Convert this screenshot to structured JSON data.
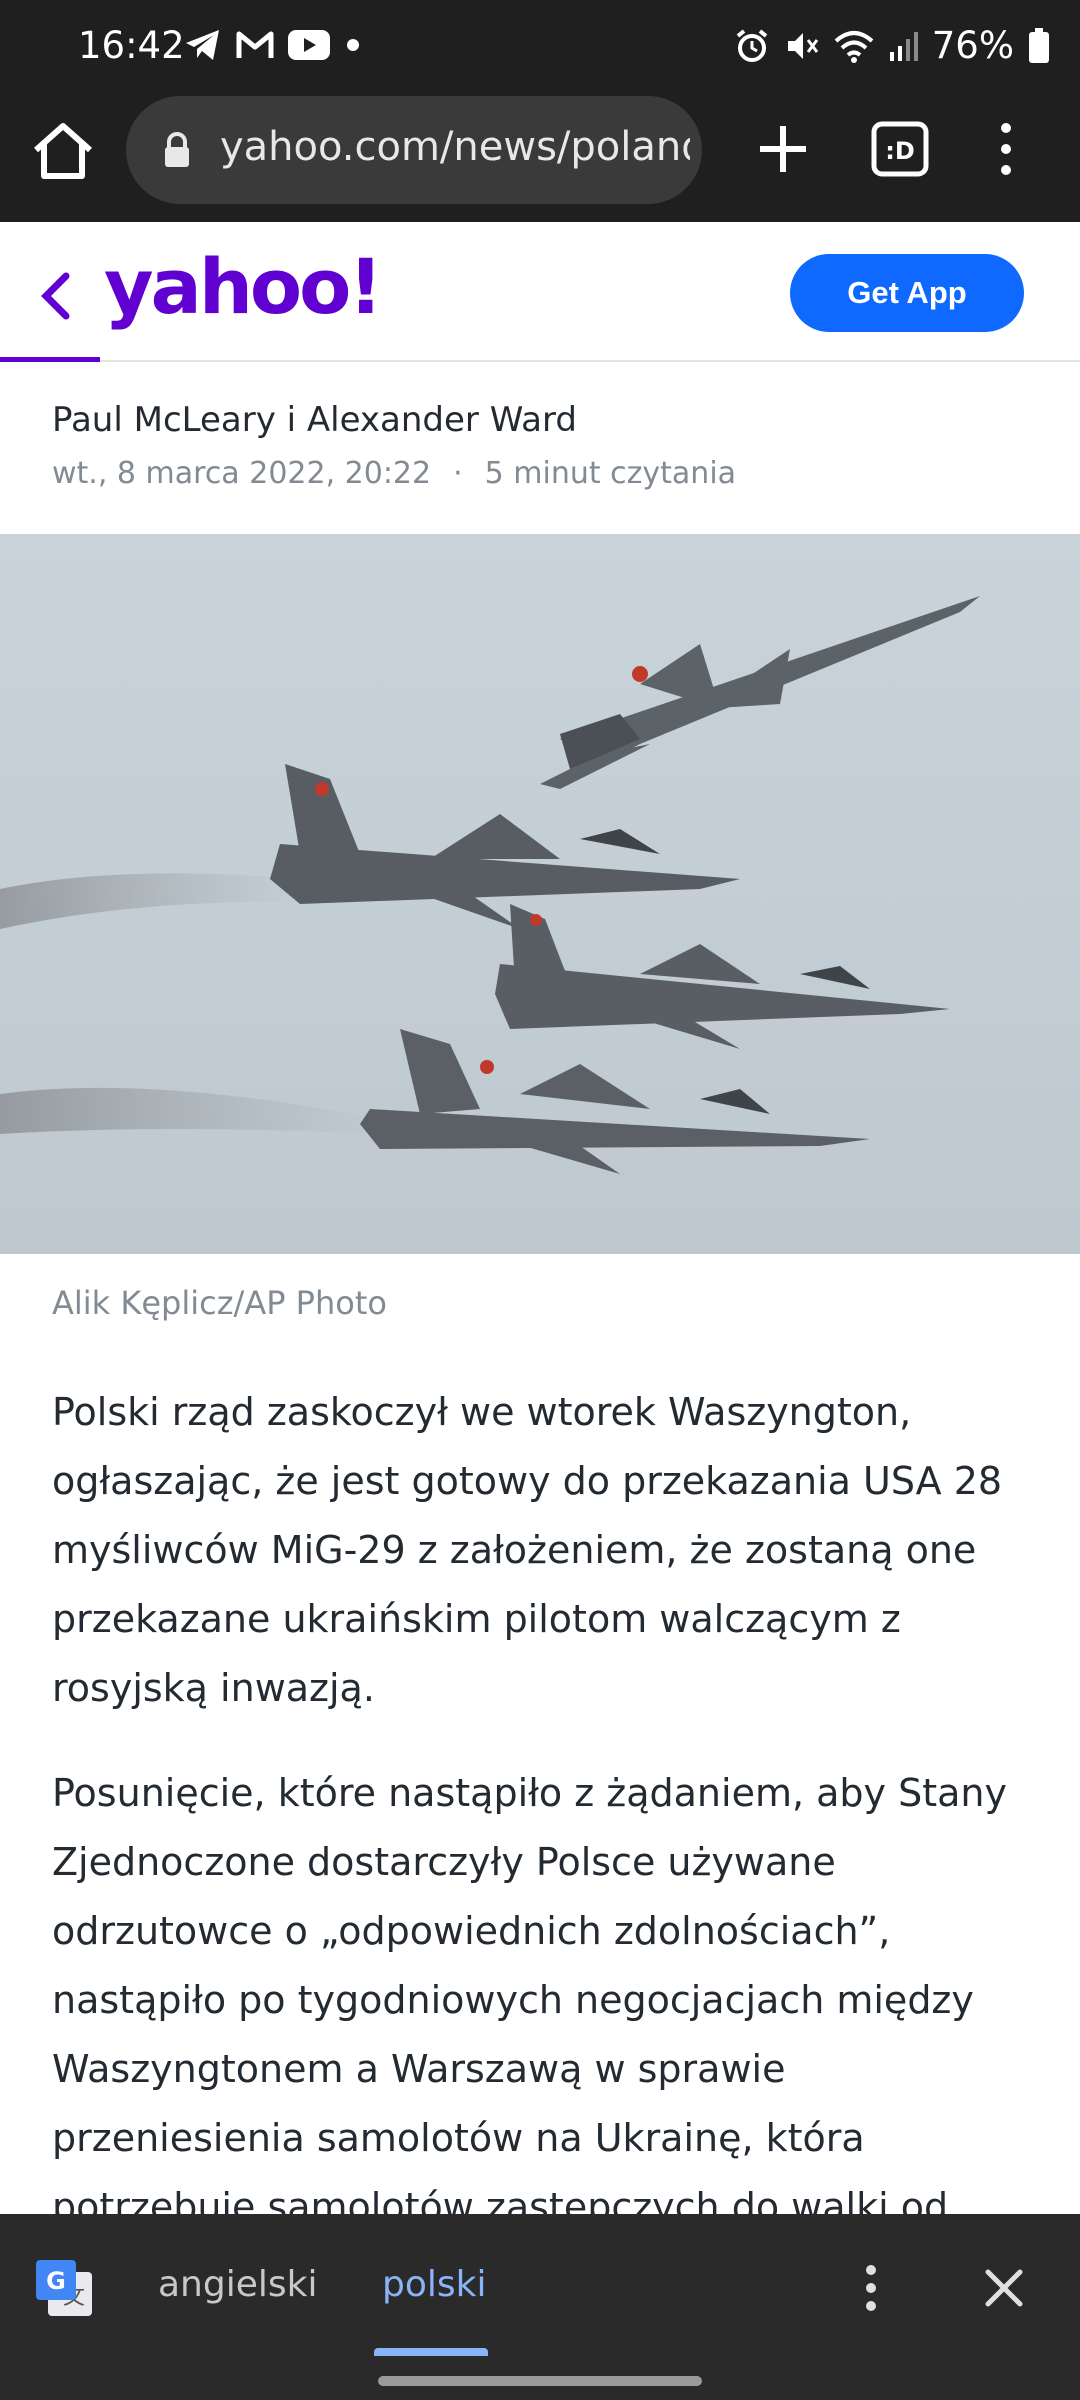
{
  "status_bar": {
    "time": "16:42",
    "battery": "76%",
    "left_icons": [
      "telegram-icon",
      "gmail-icon",
      "youtube-icon",
      "dot-icon"
    ],
    "right_icons": [
      "alarm-icon",
      "mute-icon",
      "wifi-icon",
      "signal-icon",
      "battery-icon"
    ]
  },
  "browser": {
    "url": "yahoo.com/news/poland"
  },
  "header": {
    "logo": "yahoo!",
    "get_app": "Get App"
  },
  "article": {
    "authors": "Paul McLeary i Alexander Ward",
    "date": "wt., 8 marca 2022, 20:22",
    "read_time": "5 minut czytania",
    "photo_credit": "Alik Kęplicz/AP Photo",
    "paragraphs": [
      "Polski rząd zaskoczył we wtorek Waszyngton, ogłaszając, że jest gotowy do przekazania USA 28 myśliwców MiG-29 z założeniem, że zostaną one przekazane ukraińskim pilotom walczącym z rosyjską inwazją.",
      "Posunięcie, które nastąpiło z żądaniem, aby Stany Zjednoczone dostarczyły Polsce używane odrzutowce o „odpowiednich zdolnościach”, nastąpiło po tygodniowych negocjacjach między Waszyngtonem a Warszawą w sprawie przeniesienia samolotów na Ukrainę, która potrzebuje samolotów zastępczych do walki od"
    ]
  },
  "translate": {
    "source_lang": "angielski",
    "target_lang": "polski"
  }
}
